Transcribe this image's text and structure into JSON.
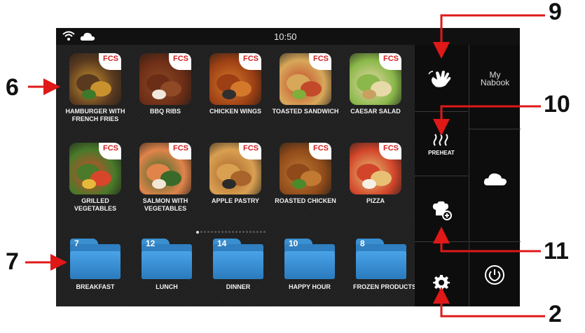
{
  "status": {
    "time": "10:50",
    "wifi_icon": "wifi-icon",
    "cloud_icon": "cloud-icon"
  },
  "badge": "FCS",
  "recipes": [
    {
      "label": "HAMBURGER WITH FRENCH FRIES",
      "colors": [
        "#5a3a1f",
        "#c9922f",
        "#3c7a2a"
      ]
    },
    {
      "label": "BBQ RIBS",
      "colors": [
        "#6b2d16",
        "#8f4a25",
        "#f0e8dc"
      ]
    },
    {
      "label": "CHICKEN WINGS",
      "colors": [
        "#9c3f14",
        "#d4792b",
        "#2f2f2f"
      ]
    },
    {
      "label": "TOASTED SANDWICH",
      "colors": [
        "#d8a85a",
        "#c24a2a",
        "#7fae3a"
      ]
    },
    {
      "label": "CAESAR SALAD",
      "colors": [
        "#8ab84a",
        "#e8d9a8",
        "#c8a060"
      ]
    },
    {
      "label": "GRILLED VEGETABLES",
      "colors": [
        "#4a7a2a",
        "#d8462a",
        "#e8b83a"
      ]
    },
    {
      "label": "SALMON WITH VEGETABLES",
      "colors": [
        "#e0844a",
        "#3a6a2a",
        "#f2e6d6"
      ]
    },
    {
      "label": "APPLE PASTRY",
      "colors": [
        "#d9a052",
        "#a8642a",
        "#2a2a2a"
      ]
    },
    {
      "label": "ROASTED CHICKEN",
      "colors": [
        "#8e4a1a",
        "#c27a32",
        "#4a8a2a"
      ]
    },
    {
      "label": "PIZZA",
      "colors": [
        "#d2452a",
        "#e8c074",
        "#f6f0e4"
      ]
    }
  ],
  "pager": {
    "pages": 20,
    "active": 0
  },
  "folders": [
    {
      "count": "7",
      "label": "BREAKFAST"
    },
    {
      "count": "12",
      "label": "LUNCH"
    },
    {
      "count": "14",
      "label": "DINNER"
    },
    {
      "count": "10",
      "label": "HAPPY HOUR"
    },
    {
      "count": "8",
      "label": "FROZEN PRODUCTS"
    }
  ],
  "sidebar": {
    "hand_icon": "hand-touch-icon",
    "preheat_label": "PREHEAT",
    "add_recipe_icon": "chef-hat-add-icon",
    "settings_icon": "gear-icon",
    "mynabook_line1": "My",
    "mynabook_line2": "Nabook",
    "cloud_icon": "cloud-icon",
    "power_icon": "power-icon"
  },
  "callouts": {
    "c9": "9",
    "c10": "10",
    "c6": "6",
    "c7": "7",
    "c11": "11",
    "c2": "2"
  },
  "colors": {
    "accent_red": "#e01818",
    "folder_blue": "#3a8fd0",
    "screen_bg": "#1d1d1d"
  }
}
